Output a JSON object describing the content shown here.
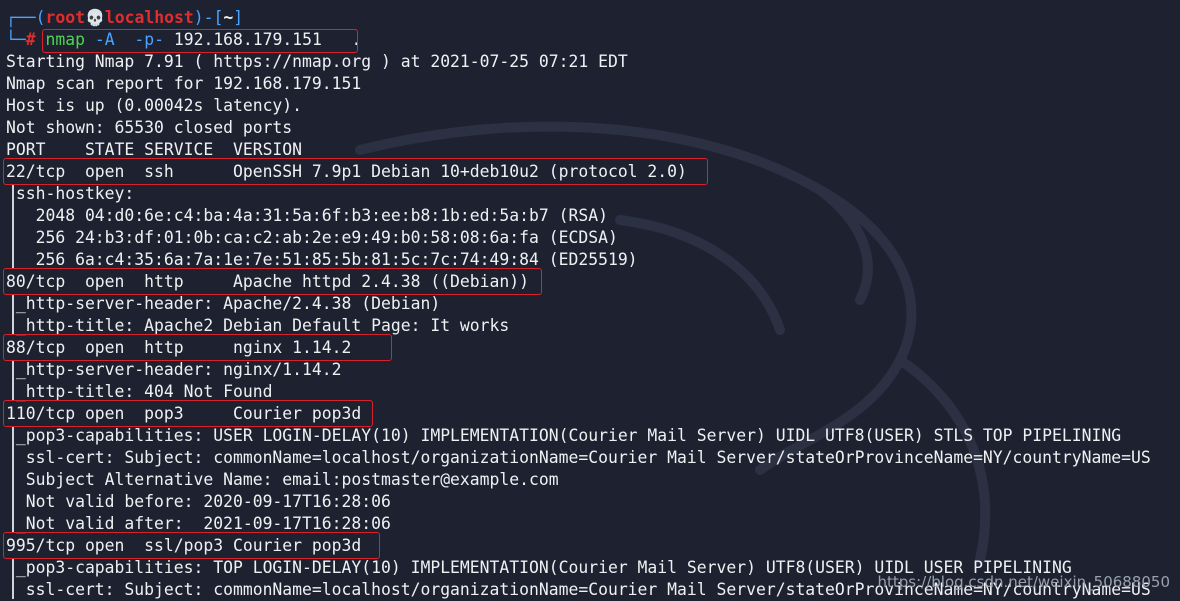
{
  "prompt": {
    "corner_top": "┌──(",
    "user": "root",
    "skull": "💀",
    "host": "localhost",
    "mid": ")-[",
    "dir": "~",
    "end": "]",
    "corner_bottom": "└─",
    "hash": "#"
  },
  "command": {
    "name": "nmap",
    "flag1": "-A",
    "flag2": "-p-",
    "target": "192.168.179.151",
    "cursor": "."
  },
  "output_lines": [
    "Starting Nmap 7.91 ( https://nmap.org ) at 2021-07-25 07:21 EDT",
    "Nmap scan report for 192.168.179.151",
    "Host is up (0.00042s latency).",
    "Not shown: 65530 closed ports",
    "PORT    STATE SERVICE  VERSION",
    "22/tcp  open  ssh      OpenSSH 7.9p1 Debian 10+deb10u2 (protocol 2.0)",
    " ssh-hostkey:",
    "   2048 04:d0:6e:c4:ba:4a:31:5a:6f:b3:ee:b8:1b:ed:5a:b7 (RSA)",
    "   256 24:b3:df:01:0b:ca:c2:ab:2e:e9:49:b0:58:08:6a:fa (ECDSA)",
    "   256 6a:c4:35:6a:7a:1e:7e:51:85:5b:81:5c:7c:74:49:84 (ED25519)",
    "80/tcp  open  http     Apache httpd 2.4.38 ((Debian))",
    " _http-server-header: Apache/2.4.38 (Debian)",
    " _http-title: Apache2 Debian Default Page: It works",
    "88/tcp  open  http     nginx 1.14.2",
    " _http-server-header: nginx/1.14.2",
    " _http-title: 404 Not Found",
    "110/tcp open  pop3     Courier pop3d",
    " _pop3-capabilities: USER LOGIN-DELAY(10) IMPLEMENTATION(Courier Mail Server) UIDL UTF8(USER) STLS TOP PIPELINING",
    "  ssl-cert: Subject: commonName=localhost/organizationName=Courier Mail Server/stateOrProvinceName=NY/countryName=US",
    "  Subject Alternative Name: email:postmaster@example.com",
    "  Not valid before: 2020-09-17T16:28:06",
    " _Not valid after:  2021-09-17T16:28:06",
    "995/tcp open  ssl/pop3 Courier pop3d",
    " _pop3-capabilities: TOP LOGIN-DELAY(10) IMPLEMENTATION(Courier Mail Server) UTF8(USER) UIDL USER PIPELINING",
    "  ssl-cert: Subject: commonName=localhost/organizationName=Courier Mail Server/stateOrProvinceName=NY/countryName=US"
  ],
  "watermark": "https://blog.csdn.net/weixin_50688050",
  "colors": {
    "background": "#1e2230",
    "text": "#eef0f2",
    "prompt_red": "#e12d2d",
    "prompt_blue": "#4aa3ff",
    "command_green": "#4bd64f",
    "highlight_box": "#d8212a"
  }
}
